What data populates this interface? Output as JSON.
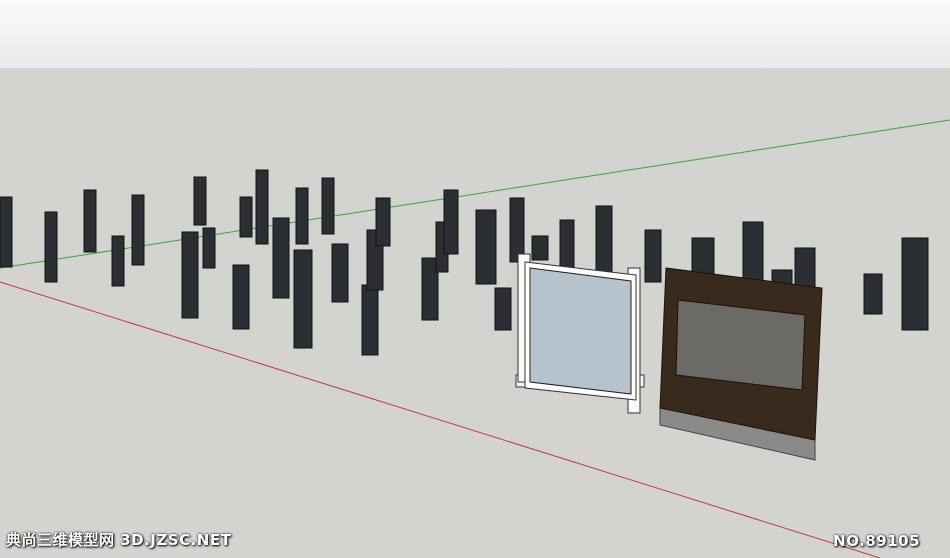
{
  "viewport": {
    "sky_color": "#f3f3f5",
    "ground_color": "#d3d3cf"
  },
  "axes": {
    "green_axis_color": "#3ca33c",
    "red_axis_color": "#c43a3a"
  },
  "scene_objects": [
    {
      "name": "lattice-panel",
      "count": 45,
      "color": "#2b2e33"
    },
    {
      "name": "white-screen",
      "color": "#ffffff",
      "glass": "#a9b8c4"
    },
    {
      "name": "wood-screen",
      "color": "#3b2a1e",
      "base": "#8a8a88"
    }
  ],
  "watermark": {
    "left_text": "典尚三维模型网 3D.JZSC.NET",
    "right_text": "NO.89105"
  }
}
